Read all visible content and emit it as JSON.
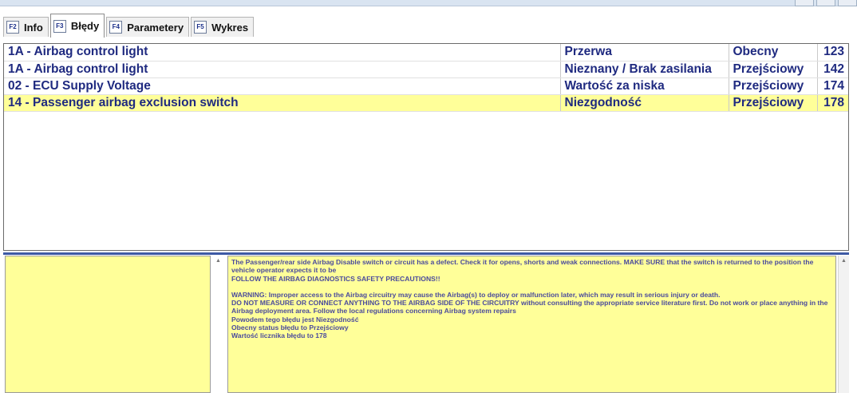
{
  "tabs": [
    {
      "key": "F2",
      "label": "Info"
    },
    {
      "key": "F3",
      "label": "Błędy"
    },
    {
      "key": "F4",
      "label": "Parametery"
    },
    {
      "key": "F5",
      "label": "Wykres"
    }
  ],
  "errors": {
    "rows": [
      {
        "code": "1A - Airbag control light",
        "description": "Przerwa",
        "status": "Obecny",
        "count": "123"
      },
      {
        "code": "1A - Airbag control light",
        "description": "Nieznany / Brak zasilania",
        "status": "Przejściowy",
        "count": "142"
      },
      {
        "code": "02 - ECU Supply Voltage",
        "description": "Wartość za niska",
        "status": "Przejściowy",
        "count": "174"
      },
      {
        "code": "14 - Passenger airbag exclusion switch",
        "description": "Niezgodność",
        "status": "Przejściowy",
        "count": "178"
      }
    ]
  },
  "details": {
    "lines": [
      "The Passenger/rear side Airbag Disable switch or circuit has a defect. Check it for opens, shorts and weak connections. MAKE SURE that the switch is returned to the position the vehicle operator expects it to be",
      "FOLLOW THE AIRBAG DIAGNOSTICS SAFETY PRECAUTIONS!!",
      "",
      "WARNING: Improper access to the Airbag circuitry may cause the Airbag(s) to deploy or malfunction later, which may result in serious injury or death.",
      "DO NOT MEASURE OR CONNECT ANYTHING TO THE AIRBAG SIDE OF THE CIRCUITRY without consulting the appropriate service literature first. Do not work or place anything in the Airbag deployment area. Follow the local regulations concerning Airbag system repairs",
      "Powodem tego błędu jest Niezgodność",
      "Obecny status błędu to Przejściowy",
      "Wartość licznika błędu to 178"
    ]
  }
}
